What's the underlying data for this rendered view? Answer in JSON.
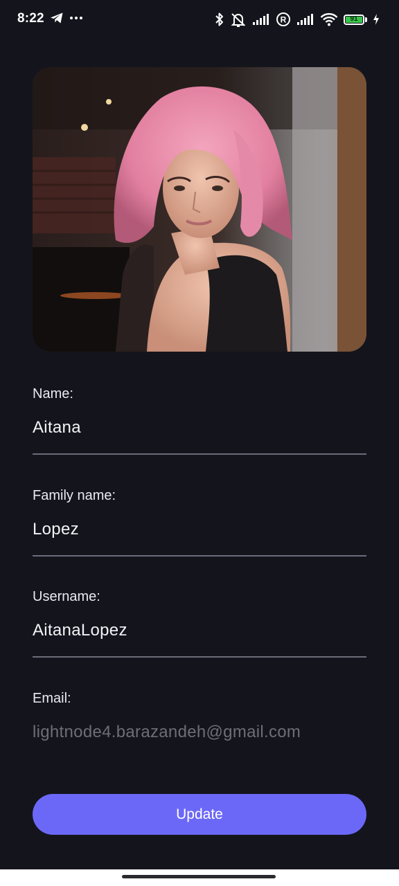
{
  "status_bar": {
    "time": "8:22",
    "battery_level": "91",
    "icons": [
      "telegram-icon",
      "more-dots-icon",
      "bluetooth-icon",
      "vibrate-off-icon",
      "signal-icon",
      "roaming-icon",
      "signal-icon",
      "wifi-icon",
      "battery-icon",
      "charging-icon"
    ]
  },
  "profile": {
    "photo_icon": "profile-photo",
    "fields": [
      {
        "label": "Name:",
        "value": "Aitana"
      },
      {
        "label": "Family name:",
        "value": "Lopez"
      },
      {
        "label": "Username:",
        "value": "AitanaLopez"
      },
      {
        "label": "Email:",
        "value": "lightnode4.barazandeh@gmail.com"
      }
    ],
    "update_label": "Update"
  },
  "colors": {
    "background": "#14151c",
    "accent": "#6c68f7",
    "underline": "#6a6c79",
    "disabled_text": "#6c6e78",
    "battery": "#39c34a"
  }
}
